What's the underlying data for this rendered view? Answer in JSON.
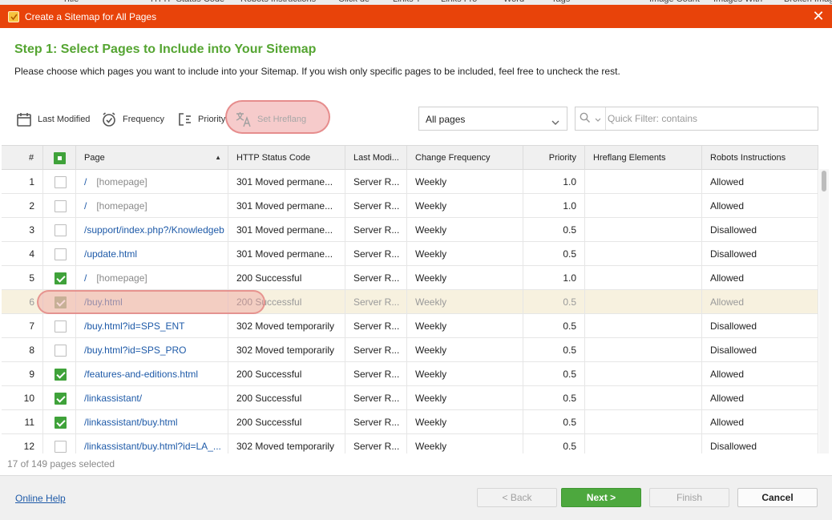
{
  "background_header": [
    "Title",
    "HTTP Status Code",
    "Robots Instructions",
    "Click de",
    "Links T",
    "Links Fro",
    "Word",
    "Tags",
    "Image Count",
    "Images With",
    "Broken Imag"
  ],
  "window": {
    "title": "Create a Sitemap for All Pages",
    "close_icon": "close-icon"
  },
  "header": {
    "title": "Step 1: Select Pages to Include into Your Sitemap",
    "description": "Please choose which pages you want to include into your Sitemap. If you wish only specific pages to be included, feel free to uncheck the rest."
  },
  "toolbar": {
    "last_modified": "Last Modified",
    "frequency": "Frequency",
    "priority": "Priority",
    "set_hreflang": "Set Hreflang"
  },
  "filter": {
    "pages_select": "All pages",
    "quick_filter_placeholder": "Quick Filter: contains"
  },
  "table": {
    "columns": {
      "num": "#",
      "page": "Page",
      "status": "HTTP Status Code",
      "last_modified": "Last Modi...",
      "frequency": "Change Frequency",
      "priority": "Priority",
      "hreflang": "Hreflang Elements",
      "robots": "Robots Instructions"
    },
    "rows": [
      {
        "num": "1",
        "checked": false,
        "page": "/",
        "homepage": "[homepage]",
        "status": "301 Moved permane...",
        "lastmod": "Server R...",
        "freq": "Weekly",
        "priority": "1.0",
        "hreflang": "",
        "robots": "Allowed"
      },
      {
        "num": "2",
        "checked": false,
        "page": "/",
        "homepage": "[homepage]",
        "status": "301 Moved permane...",
        "lastmod": "Server R...",
        "freq": "Weekly",
        "priority": "1.0",
        "hreflang": "",
        "robots": "Allowed"
      },
      {
        "num": "3",
        "checked": false,
        "page": "/support/index.php?/Knowledgeb",
        "homepage": "",
        "status": "301 Moved permane...",
        "lastmod": "Server R...",
        "freq": "Weekly",
        "priority": "0.5",
        "hreflang": "",
        "robots": "Disallowed"
      },
      {
        "num": "4",
        "checked": false,
        "page": "/update.html",
        "homepage": "",
        "status": "301 Moved permane...",
        "lastmod": "Server R...",
        "freq": "Weekly",
        "priority": "0.5",
        "hreflang": "",
        "robots": "Disallowed"
      },
      {
        "num": "5",
        "checked": true,
        "page": "/",
        "homepage": "[homepage]",
        "status": "200 Successful",
        "lastmod": "Server R...",
        "freq": "Weekly",
        "priority": "1.0",
        "hreflang": "",
        "robots": "Allowed"
      },
      {
        "num": "6",
        "checked": true,
        "page": "/buy.html",
        "homepage": "",
        "status": "200 Successful",
        "lastmod": "Server R...",
        "freq": "Weekly",
        "priority": "0.5",
        "hreflang": "",
        "robots": "Allowed",
        "highlighted": true
      },
      {
        "num": "7",
        "checked": false,
        "page": "/buy.html?id=SPS_ENT",
        "homepage": "",
        "status": "302 Moved temporarily",
        "lastmod": "Server R...",
        "freq": "Weekly",
        "priority": "0.5",
        "hreflang": "",
        "robots": "Disallowed"
      },
      {
        "num": "8",
        "checked": false,
        "page": "/buy.html?id=SPS_PRO",
        "homepage": "",
        "status": "302 Moved temporarily",
        "lastmod": "Server R...",
        "freq": "Weekly",
        "priority": "0.5",
        "hreflang": "",
        "robots": "Disallowed"
      },
      {
        "num": "9",
        "checked": true,
        "page": "/features-and-editions.html",
        "homepage": "",
        "status": "200 Successful",
        "lastmod": "Server R...",
        "freq": "Weekly",
        "priority": "0.5",
        "hreflang": "",
        "robots": "Allowed"
      },
      {
        "num": "10",
        "checked": true,
        "page": "/linkassistant/",
        "homepage": "",
        "status": "200 Successful",
        "lastmod": "Server R...",
        "freq": "Weekly",
        "priority": "0.5",
        "hreflang": "",
        "robots": "Allowed"
      },
      {
        "num": "11",
        "checked": true,
        "page": "/linkassistant/buy.html",
        "homepage": "",
        "status": "200 Successful",
        "lastmod": "Server R...",
        "freq": "Weekly",
        "priority": "0.5",
        "hreflang": "",
        "robots": "Allowed"
      },
      {
        "num": "12",
        "checked": false,
        "page": "/linkassistant/buy.html?id=LA_...",
        "homepage": "",
        "status": "302 Moved temporarily",
        "lastmod": "Server R...",
        "freq": "Weekly",
        "priority": "0.5",
        "hreflang": "",
        "robots": "Disallowed"
      }
    ]
  },
  "status": {
    "selected": "17 of 149 pages selected"
  },
  "footer": {
    "help": "Online Help",
    "back": "< Back",
    "next": "Next >",
    "finish": "Finish",
    "cancel": "Cancel"
  },
  "colors": {
    "titlebar": "#e8430a",
    "accent_green": "#55a532",
    "link_blue": "#1e5aa8"
  }
}
